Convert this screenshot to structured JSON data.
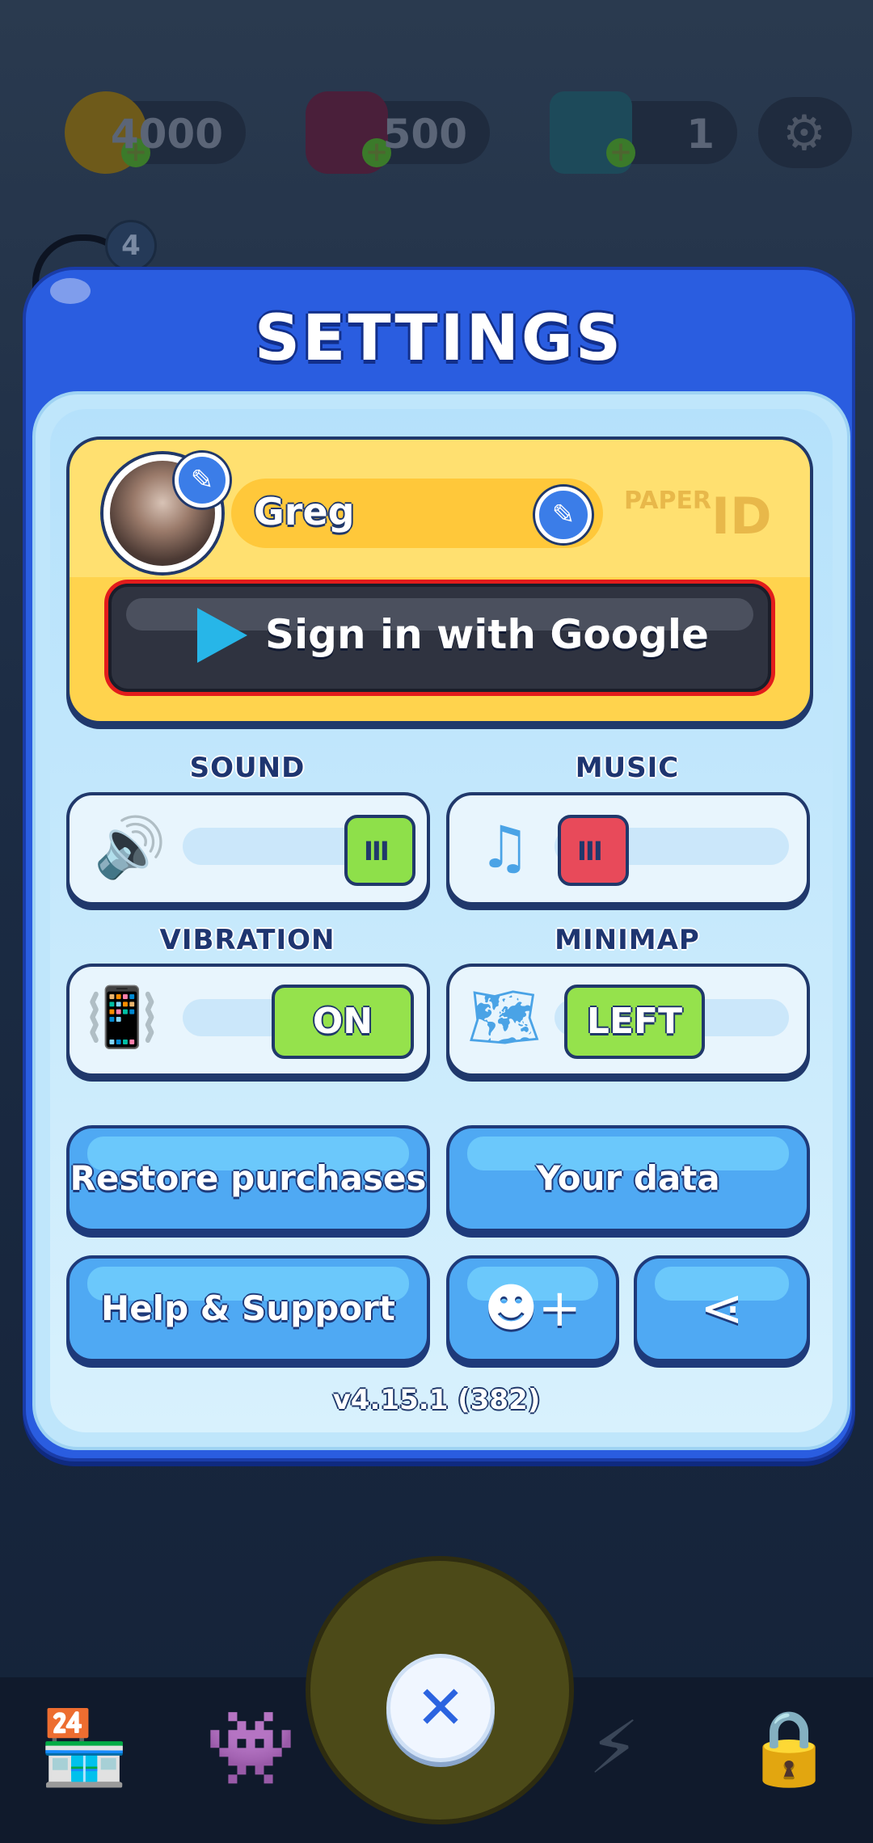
{
  "resources": {
    "coins": "4000",
    "gems": "500",
    "tickets": "1",
    "notification_count": "4"
  },
  "modal": {
    "title": "SETTINGS"
  },
  "profile": {
    "name": "Greg",
    "paper_label": "PAPER",
    "id_label": "ID",
    "google_button": "Sign in with Google"
  },
  "controls": {
    "sound_label": "SOUND",
    "music_label": "MUSIC",
    "vibration_label": "VIBRATION",
    "vibration_value": "ON",
    "minimap_label": "MINIMAP",
    "minimap_value": "LEFT",
    "sound_level": 1.0,
    "music_level": 0.0
  },
  "buttons": {
    "restore": "Restore purchases",
    "your_data": "Your data",
    "help": "Help & Support"
  },
  "version": "v4.15.1 (382)",
  "colors": {
    "modal_blue": "#2a5de0",
    "accent_green": "#8ee04a",
    "accent_red": "#e84a5a",
    "highlight_red": "#e21c1c"
  },
  "icons": {
    "coin": "coin-icon",
    "gem": "gem-icon",
    "ticket": "ticket-icon",
    "settings": "gear-icon",
    "close": "close-icon"
  }
}
